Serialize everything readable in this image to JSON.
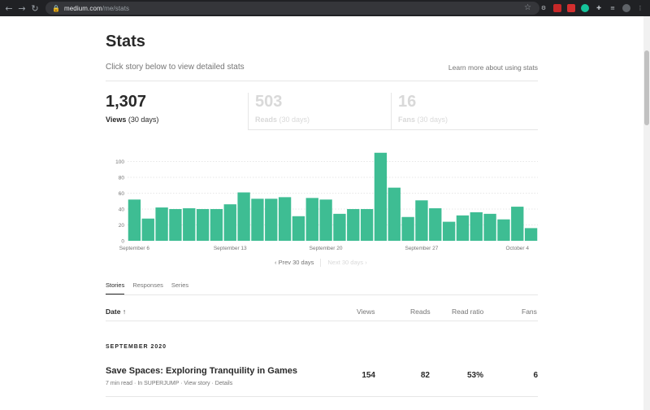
{
  "browser": {
    "url_host": "medium.com",
    "url_path": "/me/stats"
  },
  "page": {
    "title": "Stats",
    "subtitle": "Click story below to view detailed stats",
    "learn_more": "Learn more about using stats"
  },
  "stat_tabs": [
    {
      "value": "1,307",
      "label": "Views",
      "period": "(30 days)",
      "active": true
    },
    {
      "value": "503",
      "label": "Reads",
      "period": "(30 days)",
      "active": false
    },
    {
      "value": "16",
      "label": "Fans",
      "period": "(30 days)",
      "active": false
    }
  ],
  "chart_data": {
    "type": "bar",
    "ylim": [
      0,
      120
    ],
    "yticks": [
      0,
      20,
      40,
      60,
      80,
      100
    ],
    "xtick_labels": [
      {
        "index": 0,
        "label": "September 6"
      },
      {
        "index": 7,
        "label": "September 13"
      },
      {
        "index": 14,
        "label": "September 20"
      },
      {
        "index": 21,
        "label": "September 27"
      },
      {
        "index": 28,
        "label": "October 4"
      }
    ],
    "values": [
      52,
      28,
      42,
      40,
      41,
      40,
      40,
      46,
      61,
      53,
      53,
      55,
      31,
      54,
      52,
      34,
      40,
      40,
      111,
      67,
      30,
      51,
      41,
      24,
      32,
      36,
      34,
      27,
      43,
      16
    ],
    "grid": true,
    "color": "#3ebd93"
  },
  "pager": {
    "prev": "Prev 30 days",
    "next": "Next 30 days"
  },
  "subtabs": [
    "Stories",
    "Responses",
    "Series"
  ],
  "table": {
    "headers": {
      "date": "Date",
      "views": "Views",
      "reads": "Reads",
      "read_ratio": "Read ratio",
      "fans": "Fans"
    },
    "month": "SEPTEMBER 2020",
    "rows": [
      {
        "title": "Save Spaces: Exploring Tranquility in Games",
        "read_time": "7 min read",
        "publication": "In SUPERJUMP",
        "view_story": "View story",
        "details": "Details",
        "views": "154",
        "reads": "82",
        "read_ratio": "53%",
        "fans": "6"
      }
    ]
  },
  "colors": {
    "accent": "#3ebd93",
    "text": "#292929",
    "muted": "#757575",
    "faded": "#d9d9d9"
  }
}
